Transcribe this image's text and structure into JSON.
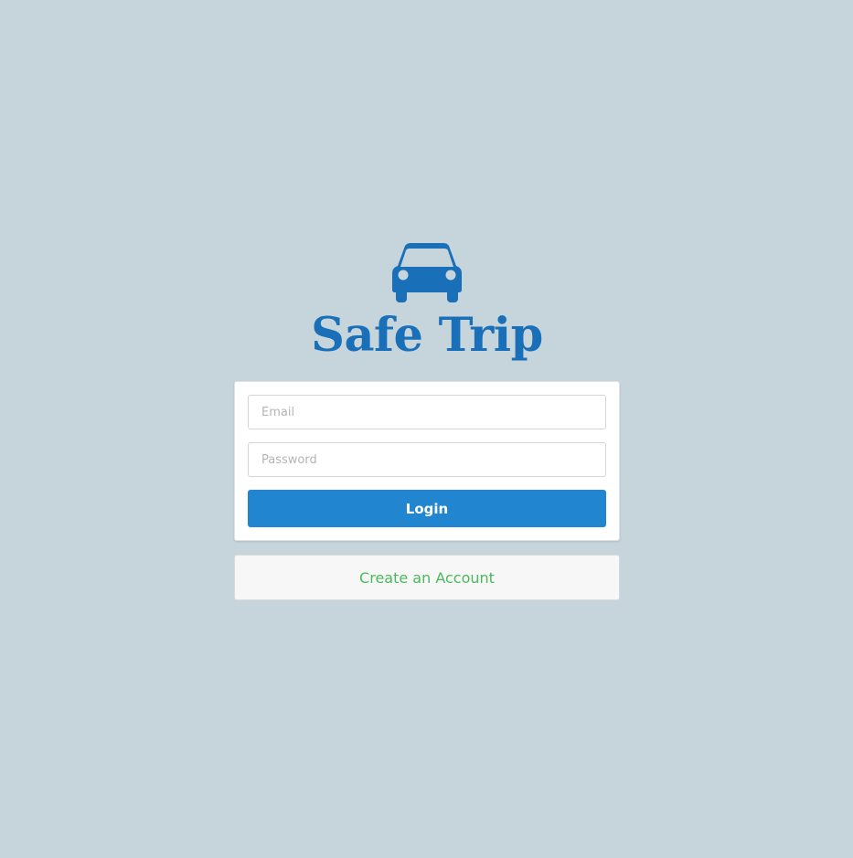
{
  "brand": {
    "title": "Safe Trip",
    "logo_icon": "car-icon",
    "color": "#1a70b8"
  },
  "form": {
    "email_placeholder": "Email",
    "email_value": "",
    "password_placeholder": "Password",
    "password_value": "",
    "login_label": "Login",
    "login_color": "#2185d0"
  },
  "create_account": {
    "label": "Create an Account",
    "color": "#4cb85c"
  },
  "colors": {
    "background": "#c6d4db"
  }
}
